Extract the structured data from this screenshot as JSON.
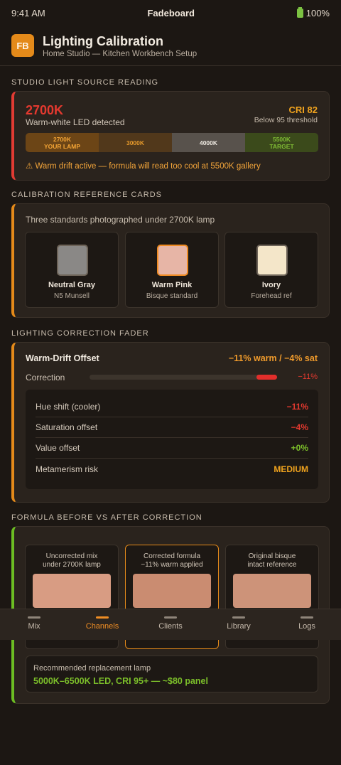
{
  "status": {
    "time": "9:41 AM",
    "app_name": "Fadeboard",
    "battery": "100%"
  },
  "header": {
    "logo": "FB",
    "title": "Lighting Calibration",
    "subtitle": "Home Studio — Kitchen Workbench Setup"
  },
  "light_source": {
    "section_label": "STUDIO LIGHT SOURCE READING",
    "kelvin": "2700K",
    "description": "Warm-white LED detected",
    "cri": "CRI 82",
    "cri_note": "Below 95 threshold",
    "segments": [
      {
        "line1": "2700K",
        "line2": "YOUR LAMP"
      },
      {
        "line1": "3000K",
        "line2": ""
      },
      {
        "line1": "4000K",
        "line2": ""
      },
      {
        "line1": "5500K",
        "line2": "TARGET"
      }
    ],
    "warning": "⚠ Warm drift active — formula will read too cool at 5500K gallery"
  },
  "reference": {
    "section_label": "CALIBRATION REFERENCE CARDS",
    "intro": "Three standards photographed under 2700K lamp",
    "cards": [
      {
        "name": "Neutral Gray",
        "sub": "N5 Munsell",
        "color": "#8a8886",
        "selected": false
      },
      {
        "name": "Warm Pink",
        "sub": "Bisque standard",
        "color": "#e7b5a6",
        "selected": true
      },
      {
        "name": "Ivory",
        "sub": "Forehead ref",
        "color": "#f4e6c9",
        "selected": false
      }
    ]
  },
  "fader": {
    "section_label": "LIGHTING CORRECTION FADER",
    "title": "Warm-Drift Offset",
    "summary": "−11% warm / −4% sat",
    "correction_label": "Correction",
    "correction_value": "−11%",
    "correction_level": -0.11,
    "metrics": [
      {
        "label": "Hue shift (cooler)",
        "value": "−11%",
        "color": "#e4392f"
      },
      {
        "label": "Saturation offset",
        "value": "−4%",
        "color": "#e4392f"
      },
      {
        "label": "Value offset",
        "value": "+0%",
        "color": "#7cbf2a"
      },
      {
        "label": "Metamerism risk",
        "value": "MEDIUM",
        "color": "#f0a31e"
      }
    ]
  },
  "formula": {
    "section_label": "FORMULA BEFORE VS AFTER CORRECTION",
    "cards": [
      {
        "caption1": "Uncorrected mix",
        "caption2": "under 2700K lamp",
        "color": "#d89c83",
        "selected": false
      },
      {
        "caption1": "Corrected formula",
        "caption2": "−11% warm applied",
        "color": "#ca8c71",
        "selected": true
      },
      {
        "caption1": "Original bisque",
        "caption2": "intact reference",
        "color": "#cd9379",
        "selected": false
      }
    ],
    "lamp_label": "Recommended replacement lamp",
    "lamp_value": "5000K–6500K LED, CRI 95+ — ~$80 panel"
  },
  "tabs": [
    {
      "label": "Mix",
      "active": false
    },
    {
      "label": "Channels",
      "active": true
    },
    {
      "label": "Clients",
      "active": false
    },
    {
      "label": "Library",
      "active": false
    },
    {
      "label": "Logs",
      "active": false
    }
  ]
}
